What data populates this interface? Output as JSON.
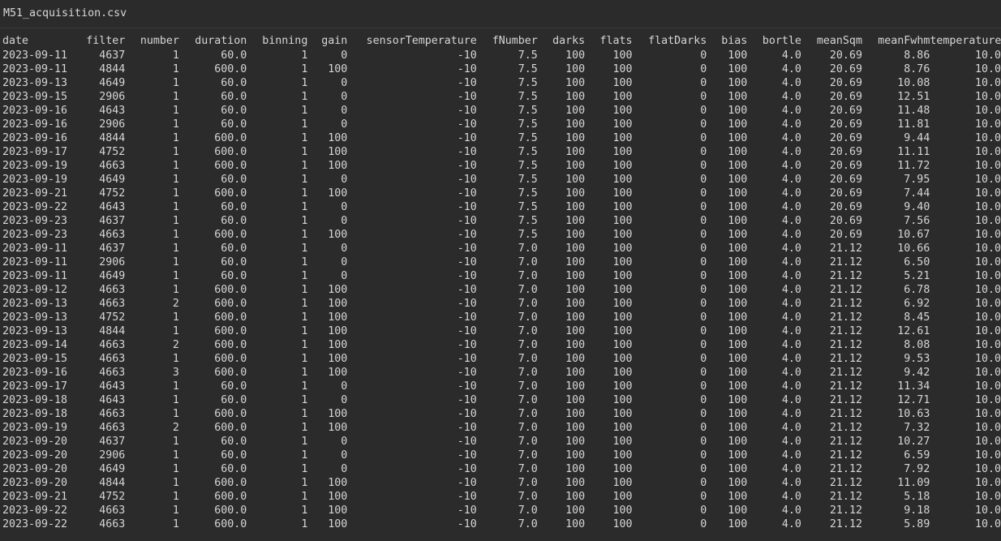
{
  "file": {
    "name": "M51_acquisition.csv"
  },
  "table": {
    "columns": [
      "date",
      "filter",
      "number",
      "duration",
      "binning",
      "gain",
      "sensorTemperature",
      "fNumber",
      "darks",
      "flats",
      "flatDarks",
      "bias",
      "bortle",
      "meanSqm",
      "meanFwhm",
      "temperature"
    ],
    "rows": [
      [
        "2023-09-11",
        "4637",
        "1",
        "60.0",
        "1",
        "0",
        "-10",
        "7.5",
        "100",
        "100",
        "0",
        "100",
        "4.0",
        "20.69",
        "8.86",
        "10.0"
      ],
      [
        "2023-09-11",
        "4844",
        "1",
        "600.0",
        "1",
        "100",
        "-10",
        "7.5",
        "100",
        "100",
        "0",
        "100",
        "4.0",
        "20.69",
        "8.76",
        "10.0"
      ],
      [
        "2023-09-13",
        "4649",
        "1",
        "60.0",
        "1",
        "0",
        "-10",
        "7.5",
        "100",
        "100",
        "0",
        "100",
        "4.0",
        "20.69",
        "10.08",
        "10.0"
      ],
      [
        "2023-09-15",
        "2906",
        "1",
        "60.0",
        "1",
        "0",
        "-10",
        "7.5",
        "100",
        "100",
        "0",
        "100",
        "4.0",
        "20.69",
        "12.51",
        "10.0"
      ],
      [
        "2023-09-16",
        "4643",
        "1",
        "60.0",
        "1",
        "0",
        "-10",
        "7.5",
        "100",
        "100",
        "0",
        "100",
        "4.0",
        "20.69",
        "11.48",
        "10.0"
      ],
      [
        "2023-09-16",
        "2906",
        "1",
        "60.0",
        "1",
        "0",
        "-10",
        "7.5",
        "100",
        "100",
        "0",
        "100",
        "4.0",
        "20.69",
        "11.81",
        "10.0"
      ],
      [
        "2023-09-16",
        "4844",
        "1",
        "600.0",
        "1",
        "100",
        "-10",
        "7.5",
        "100",
        "100",
        "0",
        "100",
        "4.0",
        "20.69",
        "9.44",
        "10.0"
      ],
      [
        "2023-09-17",
        "4752",
        "1",
        "600.0",
        "1",
        "100",
        "-10",
        "7.5",
        "100",
        "100",
        "0",
        "100",
        "4.0",
        "20.69",
        "11.11",
        "10.0"
      ],
      [
        "2023-09-19",
        "4663",
        "1",
        "600.0",
        "1",
        "100",
        "-10",
        "7.5",
        "100",
        "100",
        "0",
        "100",
        "4.0",
        "20.69",
        "11.72",
        "10.0"
      ],
      [
        "2023-09-19",
        "4649",
        "1",
        "60.0",
        "1",
        "0",
        "-10",
        "7.5",
        "100",
        "100",
        "0",
        "100",
        "4.0",
        "20.69",
        "7.95",
        "10.0"
      ],
      [
        "2023-09-21",
        "4752",
        "1",
        "600.0",
        "1",
        "100",
        "-10",
        "7.5",
        "100",
        "100",
        "0",
        "100",
        "4.0",
        "20.69",
        "7.44",
        "10.0"
      ],
      [
        "2023-09-22",
        "4643",
        "1",
        "60.0",
        "1",
        "0",
        "-10",
        "7.5",
        "100",
        "100",
        "0",
        "100",
        "4.0",
        "20.69",
        "9.40",
        "10.0"
      ],
      [
        "2023-09-23",
        "4637",
        "1",
        "60.0",
        "1",
        "0",
        "-10",
        "7.5",
        "100",
        "100",
        "0",
        "100",
        "4.0",
        "20.69",
        "7.56",
        "10.0"
      ],
      [
        "2023-09-23",
        "4663",
        "1",
        "600.0",
        "1",
        "100",
        "-10",
        "7.5",
        "100",
        "100",
        "0",
        "100",
        "4.0",
        "20.69",
        "10.67",
        "10.0"
      ],
      [
        "2023-09-11",
        "4637",
        "1",
        "60.0",
        "1",
        "0",
        "-10",
        "7.0",
        "100",
        "100",
        "0",
        "100",
        "4.0",
        "21.12",
        "10.66",
        "10.0"
      ],
      [
        "2023-09-11",
        "2906",
        "1",
        "60.0",
        "1",
        "0",
        "-10",
        "7.0",
        "100",
        "100",
        "0",
        "100",
        "4.0",
        "21.12",
        "6.50",
        "10.0"
      ],
      [
        "2023-09-11",
        "4649",
        "1",
        "60.0",
        "1",
        "0",
        "-10",
        "7.0",
        "100",
        "100",
        "0",
        "100",
        "4.0",
        "21.12",
        "5.21",
        "10.0"
      ],
      [
        "2023-09-12",
        "4663",
        "1",
        "600.0",
        "1",
        "100",
        "-10",
        "7.0",
        "100",
        "100",
        "0",
        "100",
        "4.0",
        "21.12",
        "6.78",
        "10.0"
      ],
      [
        "2023-09-13",
        "4663",
        "2",
        "600.0",
        "1",
        "100",
        "-10",
        "7.0",
        "100",
        "100",
        "0",
        "100",
        "4.0",
        "21.12",
        "6.92",
        "10.0"
      ],
      [
        "2023-09-13",
        "4752",
        "1",
        "600.0",
        "1",
        "100",
        "-10",
        "7.0",
        "100",
        "100",
        "0",
        "100",
        "4.0",
        "21.12",
        "8.45",
        "10.0"
      ],
      [
        "2023-09-13",
        "4844",
        "1",
        "600.0",
        "1",
        "100",
        "-10",
        "7.0",
        "100",
        "100",
        "0",
        "100",
        "4.0",
        "21.12",
        "12.61",
        "10.0"
      ],
      [
        "2023-09-14",
        "4663",
        "2",
        "600.0",
        "1",
        "100",
        "-10",
        "7.0",
        "100",
        "100",
        "0",
        "100",
        "4.0",
        "21.12",
        "8.08",
        "10.0"
      ],
      [
        "2023-09-15",
        "4663",
        "1",
        "600.0",
        "1",
        "100",
        "-10",
        "7.0",
        "100",
        "100",
        "0",
        "100",
        "4.0",
        "21.12",
        "9.53",
        "10.0"
      ],
      [
        "2023-09-16",
        "4663",
        "3",
        "600.0",
        "1",
        "100",
        "-10",
        "7.0",
        "100",
        "100",
        "0",
        "100",
        "4.0",
        "21.12",
        "9.42",
        "10.0"
      ],
      [
        "2023-09-17",
        "4643",
        "1",
        "60.0",
        "1",
        "0",
        "-10",
        "7.0",
        "100",
        "100",
        "0",
        "100",
        "4.0",
        "21.12",
        "11.34",
        "10.0"
      ],
      [
        "2023-09-18",
        "4643",
        "1",
        "60.0",
        "1",
        "0",
        "-10",
        "7.0",
        "100",
        "100",
        "0",
        "100",
        "4.0",
        "21.12",
        "12.71",
        "10.0"
      ],
      [
        "2023-09-18",
        "4663",
        "1",
        "600.0",
        "1",
        "100",
        "-10",
        "7.0",
        "100",
        "100",
        "0",
        "100",
        "4.0",
        "21.12",
        "10.63",
        "10.0"
      ],
      [
        "2023-09-19",
        "4663",
        "2",
        "600.0",
        "1",
        "100",
        "-10",
        "7.0",
        "100",
        "100",
        "0",
        "100",
        "4.0",
        "21.12",
        "7.32",
        "10.0"
      ],
      [
        "2023-09-20",
        "4637",
        "1",
        "60.0",
        "1",
        "0",
        "-10",
        "7.0",
        "100",
        "100",
        "0",
        "100",
        "4.0",
        "21.12",
        "10.27",
        "10.0"
      ],
      [
        "2023-09-20",
        "2906",
        "1",
        "60.0",
        "1",
        "0",
        "-10",
        "7.0",
        "100",
        "100",
        "0",
        "100",
        "4.0",
        "21.12",
        "6.59",
        "10.0"
      ],
      [
        "2023-09-20",
        "4649",
        "1",
        "60.0",
        "1",
        "0",
        "-10",
        "7.0",
        "100",
        "100",
        "0",
        "100",
        "4.0",
        "21.12",
        "7.92",
        "10.0"
      ],
      [
        "2023-09-20",
        "4844",
        "1",
        "600.0",
        "1",
        "100",
        "-10",
        "7.0",
        "100",
        "100",
        "0",
        "100",
        "4.0",
        "21.12",
        "11.09",
        "10.0"
      ],
      [
        "2023-09-21",
        "4752",
        "1",
        "600.0",
        "1",
        "100",
        "-10",
        "7.0",
        "100",
        "100",
        "0",
        "100",
        "4.0",
        "21.12",
        "5.18",
        "10.0"
      ],
      [
        "2023-09-22",
        "4663",
        "1",
        "600.0",
        "1",
        "100",
        "-10",
        "7.0",
        "100",
        "100",
        "0",
        "100",
        "4.0",
        "21.12",
        "9.18",
        "10.0"
      ],
      [
        "2023-09-22",
        "4663",
        "1",
        "600.0",
        "1",
        "100",
        "-10",
        "7.0",
        "100",
        "100",
        "0",
        "100",
        "4.0",
        "21.12",
        "5.89",
        "10.0"
      ]
    ]
  }
}
